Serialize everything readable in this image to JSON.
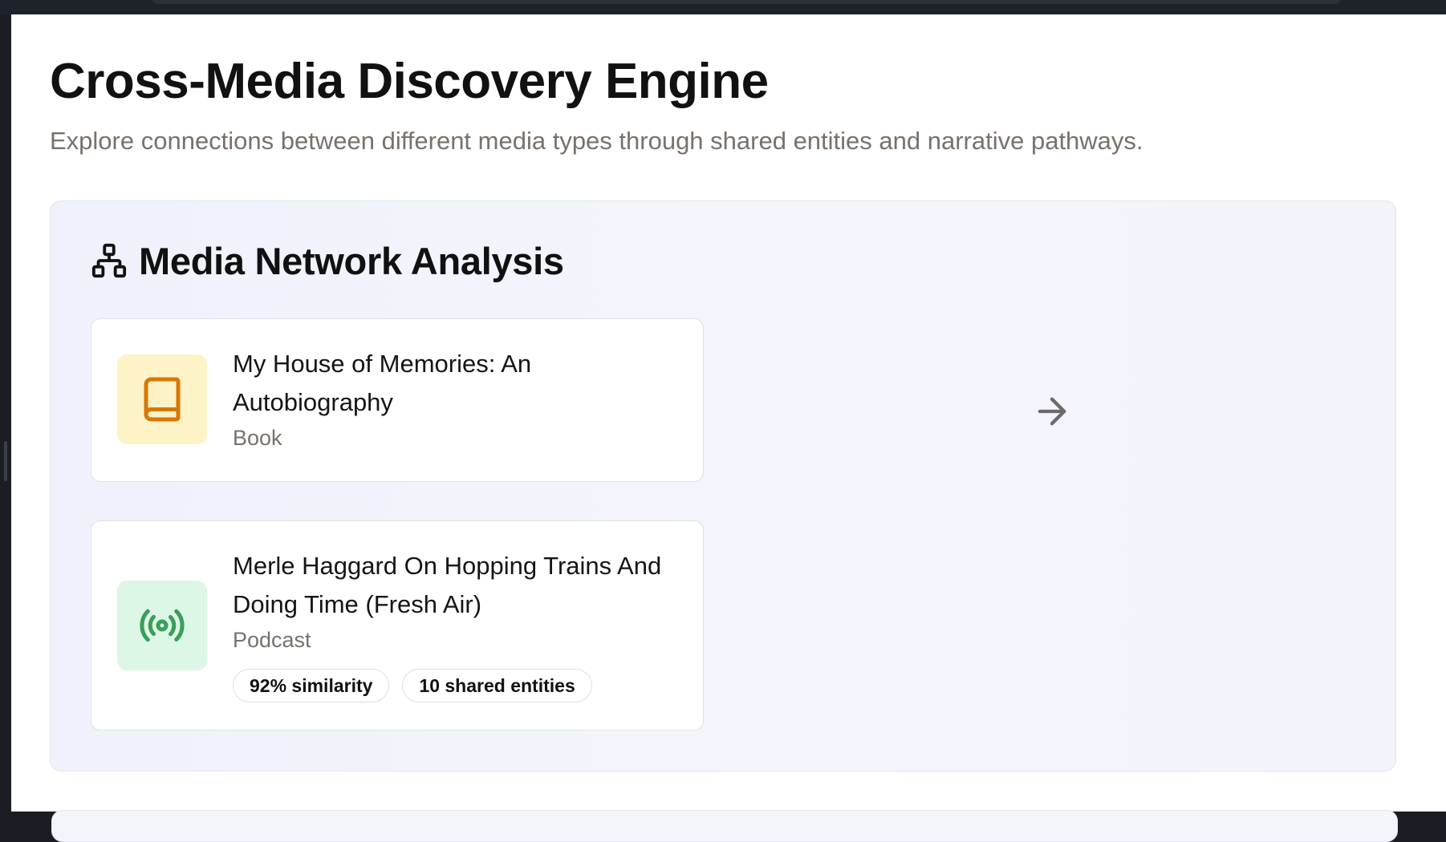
{
  "page": {
    "title": "Cross-Media Discovery Engine",
    "subtitle": "Explore connections between different media types through shared entities and narrative pathways."
  },
  "panel": {
    "title": "Media Network Analysis",
    "icon": "network-icon"
  },
  "source_media": {
    "title": "My House of Memories: An Autobiography",
    "type": "Book",
    "icon": "book-icon",
    "icon_color": "#d97706",
    "icon_bg": "#fdf3c7"
  },
  "related_media": {
    "title": "Merle Haggard On Hopping Trains And Doing Time (Fresh Air)",
    "type": "Podcast",
    "icon": "podcast-icon",
    "icon_color": "#3b9d5a",
    "icon_bg": "#dcf7e5",
    "similarity_label": "92% similarity",
    "shared_entities_label": "10 shared entities"
  },
  "connector": {
    "icon": "arrow-right-icon"
  }
}
